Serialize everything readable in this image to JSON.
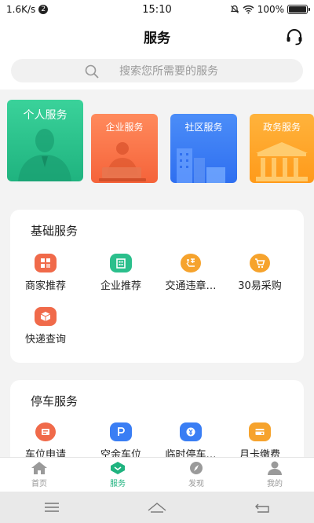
{
  "status_bar": {
    "net_speed": "1.6K/s",
    "badge": "2",
    "time": "15:10",
    "battery": "100%",
    "battery_level": 1.0
  },
  "header": {
    "title": "服务"
  },
  "search": {
    "placeholder": "搜索您所需要的服务"
  },
  "category_cards": [
    {
      "label": "个人服务",
      "color": "#22bf89"
    },
    {
      "label": "企业服务",
      "color": "#f66d43"
    },
    {
      "label": "社区服务",
      "color": "#3a7ef4"
    },
    {
      "label": "政务服务",
      "color": "#ffa62a"
    }
  ],
  "basic_services": {
    "title": "基础服务",
    "items": [
      {
        "label": "商家推荐",
        "icon": "shop-icon",
        "color": "#f06a4a"
      },
      {
        "label": "企业推荐",
        "icon": "enterprise-icon",
        "color": "#2bbf8c"
      },
      {
        "label": "交通违章…",
        "icon": "violation-icon",
        "color": "#f6a32d"
      },
      {
        "label": "30易采购",
        "icon": "cart-icon",
        "color": "#f6a32d"
      },
      {
        "label": "快递查询",
        "icon": "package-icon",
        "color": "#f06a4a"
      }
    ]
  },
  "parking_services": {
    "title": "停车服务",
    "items": [
      {
        "label": "车位申请",
        "icon": "parking-apply-icon",
        "color": "#f06a4a"
      },
      {
        "label": "空余车位",
        "icon": "parking-icon",
        "color": "#3a7ef4"
      },
      {
        "label": "临时停车…",
        "icon": "temp-parking-icon",
        "color": "#3a7ef4"
      },
      {
        "label": "月卡缴费",
        "icon": "monthly-card-icon",
        "color": "#f6a32d"
      }
    ]
  },
  "tabbar": {
    "tabs": [
      {
        "label": "首页",
        "icon": "home-icon"
      },
      {
        "label": "服务",
        "icon": "service-icon",
        "active": true
      },
      {
        "label": "发现",
        "icon": "compass-icon"
      },
      {
        "label": "我的",
        "icon": "profile-icon"
      }
    ]
  }
}
